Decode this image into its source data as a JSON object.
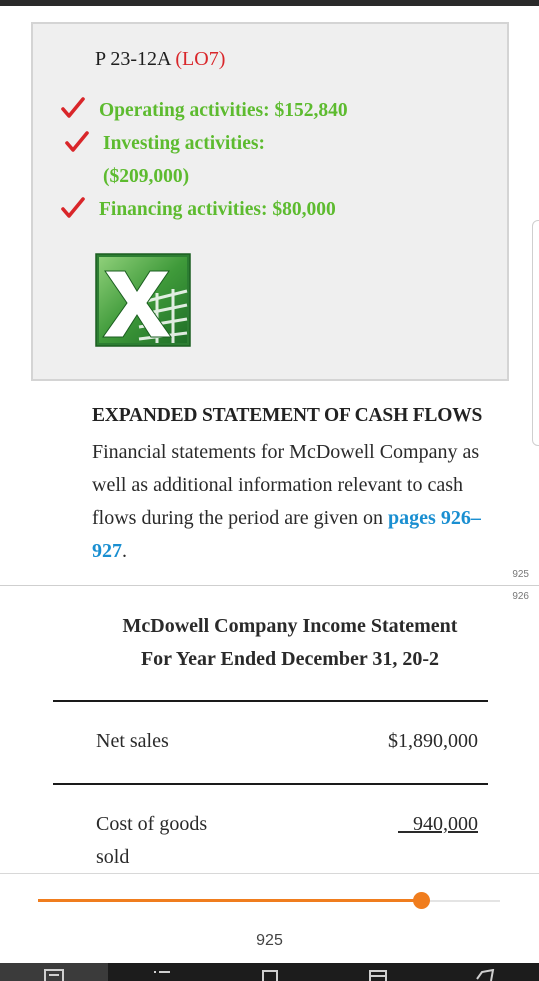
{
  "answer_box": {
    "problem_id": "P 23-12A",
    "objective": "(LO7)",
    "lines": [
      "Operating activities: $152,840",
      "Investing activities:",
      "($209,000)",
      "Financing activities: $80,000"
    ]
  },
  "section": {
    "heading": "EXPANDED STATEMENT OF CASH FLOWS",
    "text": "Financial statements for McDowell Company as well as additional information relevant to cash flows during the period are given on ",
    "link": "pages 926–927",
    "text_end": "."
  },
  "page_marks": [
    "925",
    "926"
  ],
  "statement": {
    "title_line1": "McDowell Company Income Statement",
    "title_line2": "For Year Ended December 31, 20-2",
    "rows": [
      {
        "label": "Net sales",
        "value": "$1,890,000"
      },
      {
        "label": "Cost of goods sold",
        "value": "940,000"
      }
    ]
  },
  "reader": {
    "current_page": "925",
    "progress_fraction": 0.83,
    "accent": "#f07d1e"
  },
  "colors": {
    "answer_green": "#5dbb2f",
    "lo_red": "#d9262a",
    "link_blue": "#1a8fd1",
    "check_red": "#d9262a"
  }
}
